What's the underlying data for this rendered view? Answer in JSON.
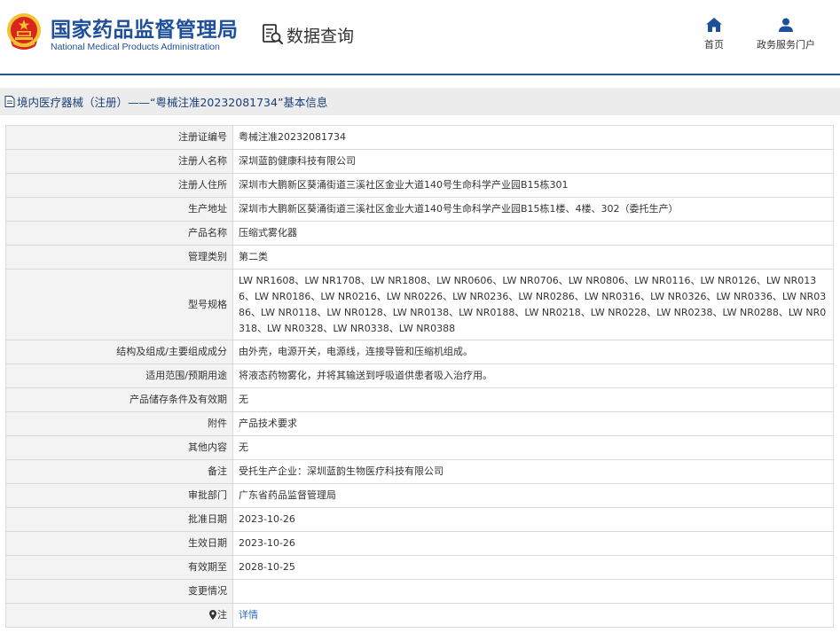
{
  "header": {
    "org_name_cn": "国家药品监督管理局",
    "org_name_en": "National Medical Products Administration",
    "query_label": "数据查询",
    "nav": [
      {
        "label": "首页",
        "icon": "home-icon"
      },
      {
        "label": "政务服务门户",
        "icon": "user-icon"
      }
    ]
  },
  "page_title": "境内医疗器械（注册）——“粤械注准20232081734”基本信息",
  "colors": {
    "brand_blue": "#1e4f9a",
    "link_blue": "#2f6fbf",
    "label_bg": "#f3f3f3",
    "title_bar_bg": "#ececec",
    "emblem_red": "#d9251c",
    "emblem_gold": "#f2c230"
  },
  "rows": [
    {
      "label": "注册证编号",
      "value": "粤械注准20232081734"
    },
    {
      "label": "注册人名称",
      "value": "深圳蓝韵健康科技有限公司"
    },
    {
      "label": "注册人住所",
      "value": "深圳市大鹏新区葵涌街道三溪社区金业大道140号生命科学产业园B15栋301"
    },
    {
      "label": "生产地址",
      "value": "深圳市大鹏新区葵涌街道三溪社区金业大道140号生命科学产业园B15栋1楼、4楼、302（委托生产）"
    },
    {
      "label": "产品名称",
      "value": "压缩式雾化器"
    },
    {
      "label": "管理类别",
      "value": "第二类"
    },
    {
      "label": "型号规格",
      "value": "LW NR1608、LW NR1708、LW NR1808、LW NR0606、LW NR0706、LW NR0806、LW NR0116、LW NR0126、LW NR0136、LW NR0186、LW NR0216、LW NR0226、LW NR0236、LW NR0286、LW NR0316、LW NR0326、LW NR0336、LW NR0386、LW NR0118、LW NR0128、LW NR0138、LW NR0188、LW NR0218、LW NR0228、LW NR0238、LW NR0288、LW NR0318、LW NR0328、LW NR0338、LW NR0388"
    },
    {
      "label": "结构及组成/主要组成成分",
      "value": "由外壳，电源开关，电源线，连接导管和压缩机组成。"
    },
    {
      "label": "适用范围/预期用途",
      "value": "将液态药物雾化，并将其输送到呼吸道供患者吸入治疗用。"
    },
    {
      "label": "产品储存条件及有效期",
      "value": "无"
    },
    {
      "label": "附件",
      "value": "产品技术要求"
    },
    {
      "label": "其他内容",
      "value": "无"
    },
    {
      "label": "备注",
      "value": "受托生产企业：深圳蓝韵生物医疗科技有限公司"
    },
    {
      "label": "审批部门",
      "value": "广东省药品监督管理局"
    },
    {
      "label": "批准日期",
      "value": "2023-10-26"
    },
    {
      "label": "生效日期",
      "value": "2023-10-26"
    },
    {
      "label": "有效期至",
      "value": "2028-10-25"
    },
    {
      "label": "变更情况",
      "value": ""
    }
  ],
  "note_row": {
    "label": "注",
    "link_text": "详情",
    "icon": "location-pin-icon"
  }
}
